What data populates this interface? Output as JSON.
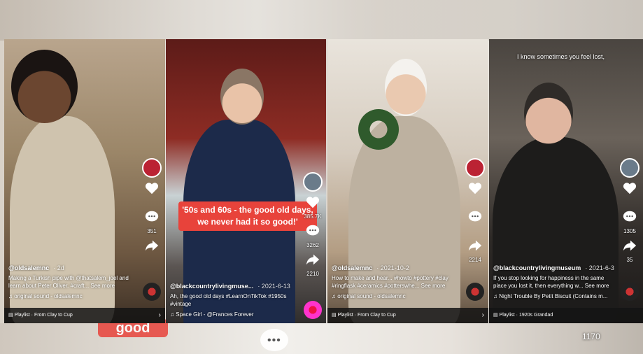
{
  "background": {
    "ghost_caption": "good",
    "ghost_count": "1170"
  },
  "panels": [
    {
      "username": "@oldsalemnc",
      "date": "· 2d",
      "caption": "Making a Turkish pipe with @thatsalem_joel and learn about Peter Oliver. #craft... See more",
      "sound": "original sound - oldsalemnc",
      "rail_counts": [
        "",
        "351",
        "",
        ""
      ],
      "playlist": "Playlist · From Clay to Cup"
    },
    {
      "username": "@blackcountrylivingmuse...",
      "date": "· 2021-6-13",
      "caption": "Ah, the good old days #LearnOnTikTok #1950s #vintage",
      "sound": "Space Girl - @Frances Forever",
      "quote": "'50s and 60s - the good old days, we never had it so good!'",
      "rail_counts": [
        "385.7K",
        "3262",
        "2210"
      ],
      "playlist": ""
    },
    {
      "username": "@oldsalemnc",
      "date": "· 2021-10-2",
      "caption": "How to make and hear... #howto #pottery #clay #ringflask #ceramics #potterswhe... See more",
      "sound": "original sound - oldsalemnc",
      "rail_counts": [
        "",
        "",
        "2214"
      ],
      "playlist": "Playlist · From Clay to Cup"
    },
    {
      "username": "@blackcountrylivingmuseum",
      "date": "· 2021-6-3",
      "caption": "If you stop looking for happiness in the same place you lost it, then everything w... See more",
      "sound": "Night Trouble By Petit Biscuit (Contains m...",
      "overlay": "I know sometimes you feel lost,",
      "rail_counts": [
        "",
        "",
        "1305",
        "35"
      ],
      "playlist": "Playlist · 1920s Grandad"
    }
  ],
  "icons": {
    "like": "heart-icon",
    "comment": "comment-icon",
    "share": "share-icon",
    "music": "music-note-icon",
    "playlist": "playlist-icon"
  },
  "colors": {
    "accent": "#e8433b",
    "text": "#ffffff",
    "bar": "#141414"
  }
}
